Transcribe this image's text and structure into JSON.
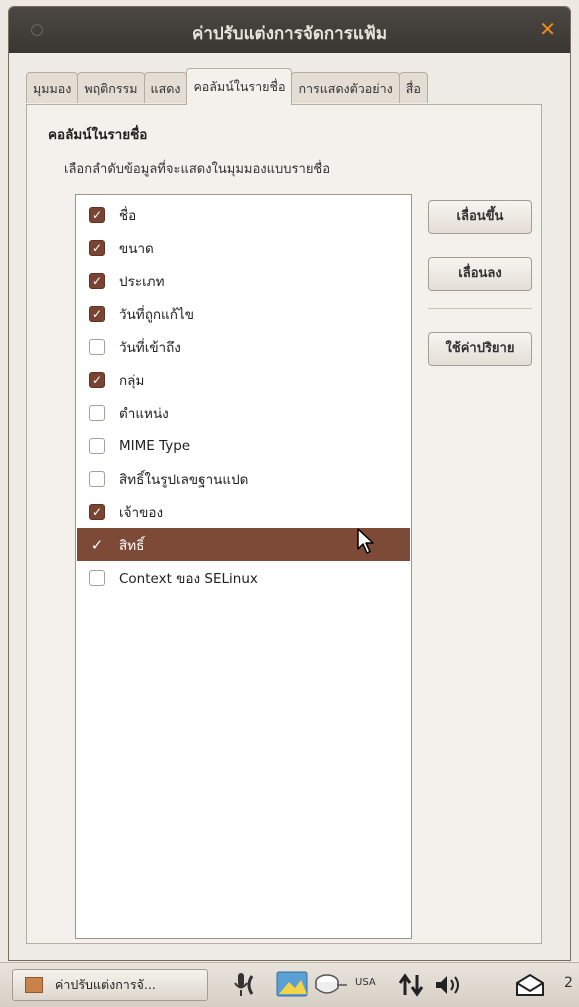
{
  "window": {
    "title": "ค่าปรับแต่งการจัดการแฟ้ม"
  },
  "tabs": [
    {
      "label": "มุมมอง",
      "active": false
    },
    {
      "label": "พฤติกรรม",
      "active": false
    },
    {
      "label": "แสดง",
      "active": false
    },
    {
      "label": "คอลัมน์ในรายชื่อ",
      "active": true
    },
    {
      "label": "การแสดงตัวอย่าง",
      "active": false
    },
    {
      "label": "สื่อ",
      "active": false
    }
  ],
  "section": {
    "title": "คอลัมน์ในรายชื่อ",
    "description": "เลือกลำดับข้อมูลที่จะแสดงในมุมมองแบบรายชื่อ"
  },
  "columns": [
    {
      "label": "ชื่อ",
      "checked": true,
      "selected": false
    },
    {
      "label": "ขนาด",
      "checked": true,
      "selected": false
    },
    {
      "label": "ประเภท",
      "checked": true,
      "selected": false
    },
    {
      "label": "วันที่ถูกแก้ไข",
      "checked": true,
      "selected": false
    },
    {
      "label": "วันที่เข้าถึง",
      "checked": false,
      "selected": false
    },
    {
      "label": "กลุ่ม",
      "checked": true,
      "selected": false
    },
    {
      "label": "ตำแหน่ง",
      "checked": false,
      "selected": false
    },
    {
      "label": "MIME Type",
      "checked": false,
      "selected": false
    },
    {
      "label": "สิทธิ์ในรูปเลขฐานแปด",
      "checked": false,
      "selected": false
    },
    {
      "label": "เจ้าของ",
      "checked": true,
      "selected": false
    },
    {
      "label": "สิทธิ์",
      "checked": true,
      "selected": true
    },
    {
      "label": "Context ของ SELinux",
      "checked": false,
      "selected": false
    }
  ],
  "buttons": {
    "move_up": "เลื่อนขึ้น",
    "move_down": "เลื่อนลง",
    "use_default": "ใช้ค่าปริยาย"
  },
  "taskbar": {
    "task_label": "ค่าปรับแต่งการจั...",
    "keyboard_layout": "USA",
    "clock_partial": "2"
  },
  "colors": {
    "titlebar": "#3f3b37",
    "selection": "#7d4a37",
    "close_accent": "#f08a1d"
  }
}
